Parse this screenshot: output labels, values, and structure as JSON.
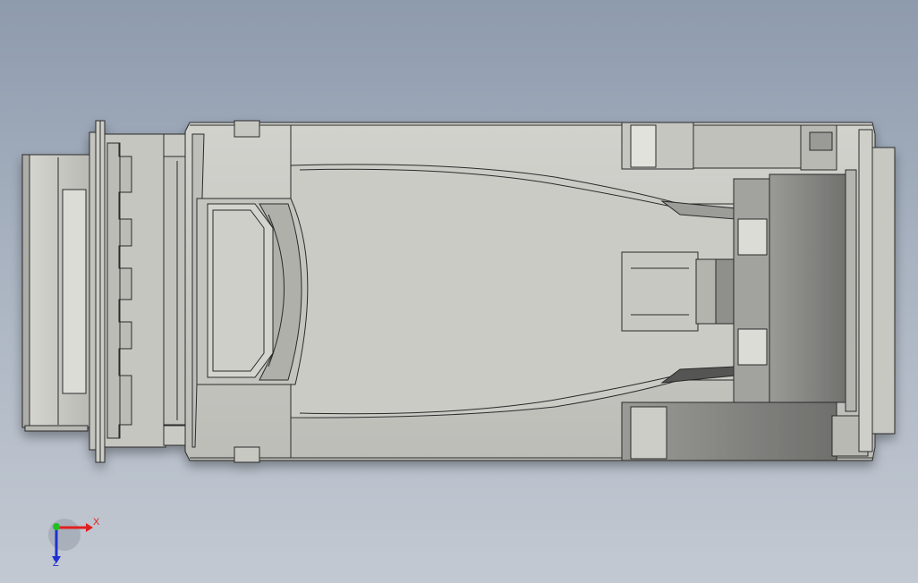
{
  "viewport": {
    "background_top": "#8e9bad",
    "background_bottom": "#c3c9d2",
    "model_fill": "#c9c9c4",
    "model_dark_fill": "#8a8a86",
    "outline": "#2a2a2a"
  },
  "triad": {
    "x_label": "X",
    "z_label": "Z",
    "x_color": "#e02020",
    "y_color": "#20c020",
    "z_color": "#2030d0"
  }
}
